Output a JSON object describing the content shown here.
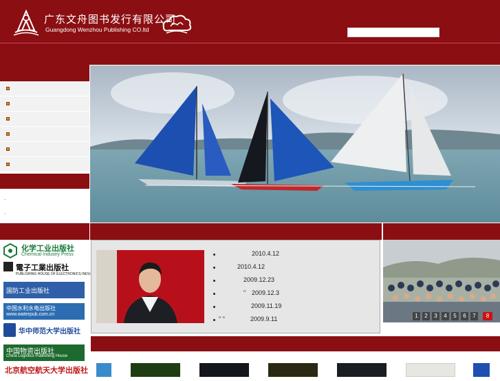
{
  "header": {
    "title_cn": "广东文舟图书发行有限公司",
    "title_en": "Guangdong Wenzhou Publishing CO.ltd",
    "search": {
      "value": "",
      "placeholder": ""
    }
  },
  "colors": {
    "brand": "#8b0f12",
    "bullet": "#d1901a",
    "active_page": "#cc1111"
  },
  "sidebar": {
    "items": [
      "",
      "",
      "",
      "",
      "",
      ""
    ],
    "bullet_icon": "square-bullet-icon",
    "footer_marks": [
      ".",
      "."
    ]
  },
  "publishers": [
    {
      "cn": "化学工业出版社",
      "en": "Chemical Industry Press"
    },
    {
      "cn": "電子工業出版社",
      "en": "PUBLISHING HOUSE OF ELECTRONICS INDUSTRY"
    },
    {
      "cn": "国防工业出版社",
      "en": ""
    },
    {
      "cn": "中国水利水电出版社",
      "en": "www.waterpub.com.cn"
    },
    {
      "cn": "华中师范大学出版社",
      "en": ""
    },
    {
      "cn": "中国物资出版社",
      "en": "China Logistics Publishing House"
    },
    {
      "cn": "北京航空航天大学出版社",
      "en": ""
    }
  ],
  "news": [
    {
      "title": "",
      "date": "2010.4.12"
    },
    {
      "title": "",
      "date": "2010.4.12"
    },
    {
      "title": "",
      "date": "2009.12.23"
    },
    {
      "title": "\"",
      "date": "2009.12.3"
    },
    {
      "title": "",
      "date": "2009.11.19"
    },
    {
      "title": "\" \"",
      "date": "2009.9.11"
    }
  ],
  "pager": {
    "pages": [
      "1",
      "2",
      "3",
      "4",
      "5",
      "6",
      "7",
      "8"
    ],
    "active": "8"
  }
}
